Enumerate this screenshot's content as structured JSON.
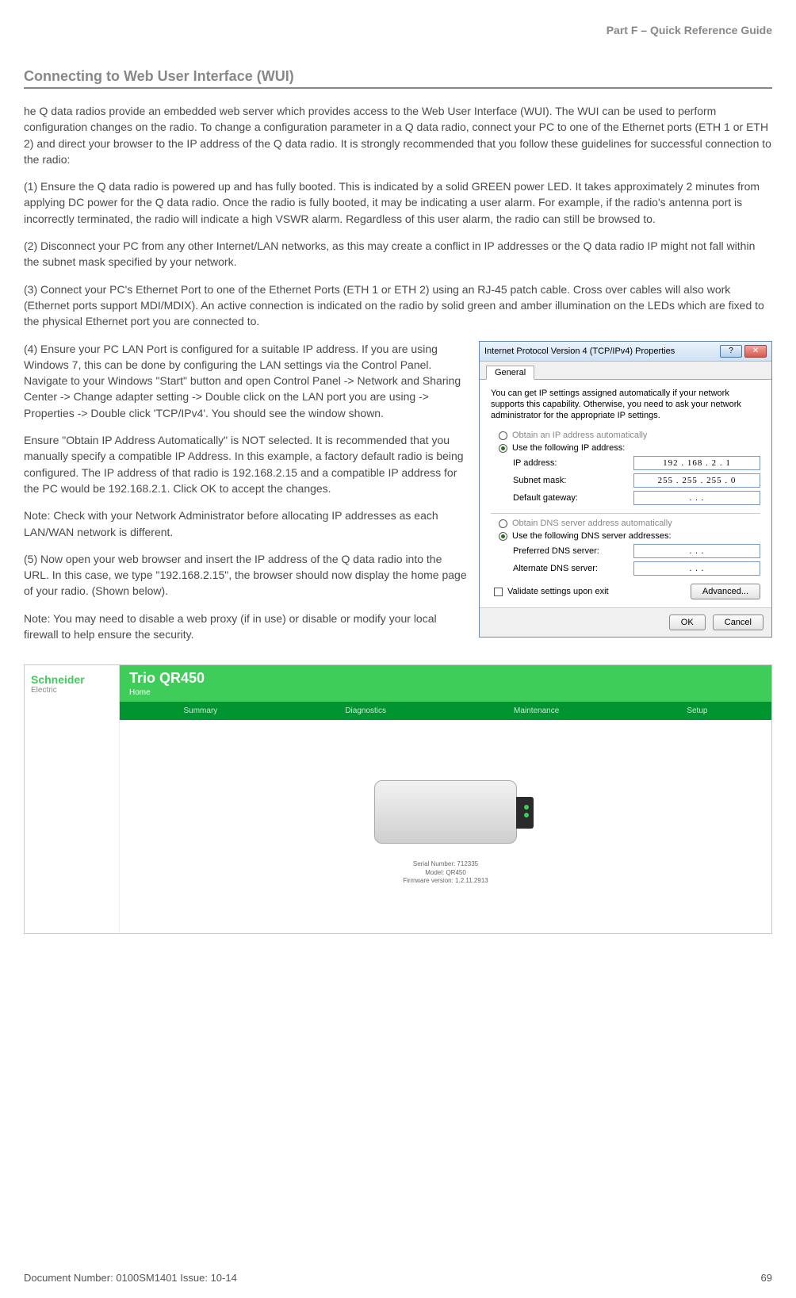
{
  "header": {
    "part_label": "Part F – Quick Reference Guide"
  },
  "section": {
    "title": "Connecting to Web User Interface (WUI)"
  },
  "paragraphs": {
    "intro": "he Q data radios provide an embedded web server which provides access to the Web User Interface (WUI). The WUI can be used to perform configuration changes on the radio. To change a configuration parameter in a Q data radio, connect your PC to one of the Ethernet ports (ETH 1 or ETH 2) and direct your browser to the IP address of the Q data radio. It is strongly recommended that you follow these guidelines for successful connection to the radio:",
    "p1": "(1) Ensure the Q data radio is powered up and has fully booted. This is indicated by a solid GREEN power LED. It takes approximately 2 minutes from applying DC power for the Q data radio. Once the radio is fully booted, it may be indicating a user alarm. For example, if the radio's antenna port is incorrectly terminated, the radio will indicate a high VSWR alarm. Regardless of this user alarm, the radio can still be browsed to.",
    "p2": "(2) Disconnect your PC from any other Internet/LAN networks, as this may create a conflict in IP addresses or the Q data radio IP might not fall within the subnet mask specified by your network.",
    "p3": "(3) Connect your PC's Ethernet Port to one of the Ethernet Ports (ETH 1 or ETH 2) using an RJ-45 patch cable. Cross over cables will also work (Ethernet ports support MDI/MDIX). An active connection is indicated on the radio by solid green and amber illumination on the LEDs which are fixed to the physical Ethernet port you are connected to.",
    "p4a": "(4) Ensure your PC LAN Port is configured for a suitable IP address. If you are using Windows 7, this can be done by configuring the LAN settings via the Control Panel. Navigate to your Windows \"Start\" button and open Control Panel -> Network and Sharing Center -> Change adapter setting -> Double click on the LAN port you are using -> Properties -> Double click 'TCP/IPv4'. You should see the window shown.",
    "p4b": "Ensure \"Obtain IP Address Automatically\" is NOT selected. It is recommended that you manually specify a compatible IP Address. In this example, a factory default radio is being configured. The IP address of that radio is 192.168.2.15 and a compatible IP address for the PC would be 192.168.2.1. Click OK to accept the changes.",
    "note1": "Note: Check with your Network Administrator before allocating IP addresses as each LAN/WAN network is different.",
    "p5": "(5) Now open your web browser and insert the IP address of the Q data radio into the URL. In this case, we type \"192.168.2.15\", the browser should now display the home page of your radio. (Shown below).",
    "note2": "Note: You may need to disable a web proxy (if in use) or disable or modify your local firewall to help ensure the security."
  },
  "dialog": {
    "title": "Internet Protocol Version 4 (TCP/IPv4) Properties",
    "tab": "General",
    "description": "You can get IP settings assigned automatically if your network supports this capability. Otherwise, you need to ask your network administrator for the appropriate IP settings.",
    "radio_auto_ip": "Obtain an IP address automatically",
    "radio_use_ip": "Use the following IP address:",
    "ip_label": "IP address:",
    "ip_value": "192 . 168 .   2   .   1",
    "subnet_label": "Subnet mask:",
    "subnet_value": "255 . 255 . 255 .   0",
    "gateway_label": "Default gateway:",
    "gateway_value": ".       .       .",
    "radio_auto_dns": "Obtain DNS server address automatically",
    "radio_use_dns": "Use the following DNS server addresses:",
    "pref_dns_label": "Preferred DNS server:",
    "pref_dns_value": ".       .       .",
    "alt_dns_label": "Alternate DNS server:",
    "alt_dns_value": ".       .       .",
    "validate_label": "Validate settings upon exit",
    "advanced_btn": "Advanced...",
    "ok_btn": "OK",
    "cancel_btn": "Cancel"
  },
  "wui": {
    "brand": "Schneider",
    "brand_sub": "Electric",
    "model": "Trio QR450",
    "home": "Home",
    "nav": [
      "Summary",
      "Diagnostics",
      "Maintenance",
      "Setup"
    ],
    "side1": "",
    "side2": "",
    "info_serial": "Serial Number:  712335",
    "info_model": "Model:  QR450",
    "info_fw": "Firmware version:  1.2.11.2913"
  },
  "footer": {
    "doc": "Document Number: 0100SM1401   Issue: 10-14",
    "page": "69"
  }
}
